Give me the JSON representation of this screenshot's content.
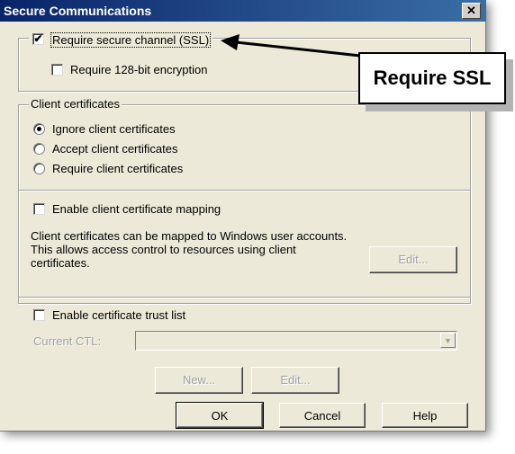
{
  "window": {
    "title": "Secure Communications",
    "close_label": "✕"
  },
  "secure_channel": {
    "require_ssl": {
      "label": "Require secure channel (SSL)",
      "checked": true
    },
    "require_128": {
      "label": "Require 128-bit encryption",
      "checked": false
    }
  },
  "client_certificates": {
    "legend": "Client certificates",
    "options": [
      {
        "label": "Ignore client certificates",
        "selected": true
      },
      {
        "label": "Accept client certificates",
        "selected": false
      },
      {
        "label": "Require client certificates",
        "selected": false
      }
    ],
    "enable_mapping": {
      "label": "Enable client certificate mapping",
      "checked": false
    },
    "mapping_description": "Client certificates can be mapped to Windows user accounts.  This allows access control to resources using client certificates.",
    "edit_label": "Edit..."
  },
  "trust_list": {
    "enable_ctl": {
      "label": "Enable certificate trust list",
      "checked": false
    },
    "current_ctl_label": "Current CTL:",
    "current_ctl_value": "",
    "new_label": "New...",
    "edit_label": "Edit..."
  },
  "footer": {
    "ok_label": "OK",
    "cancel_label": "Cancel",
    "help_label": "Help"
  },
  "annotation": {
    "callout_text": "Require SSL"
  },
  "icons": {
    "check": "✔",
    "combo_arrow": "▼"
  }
}
